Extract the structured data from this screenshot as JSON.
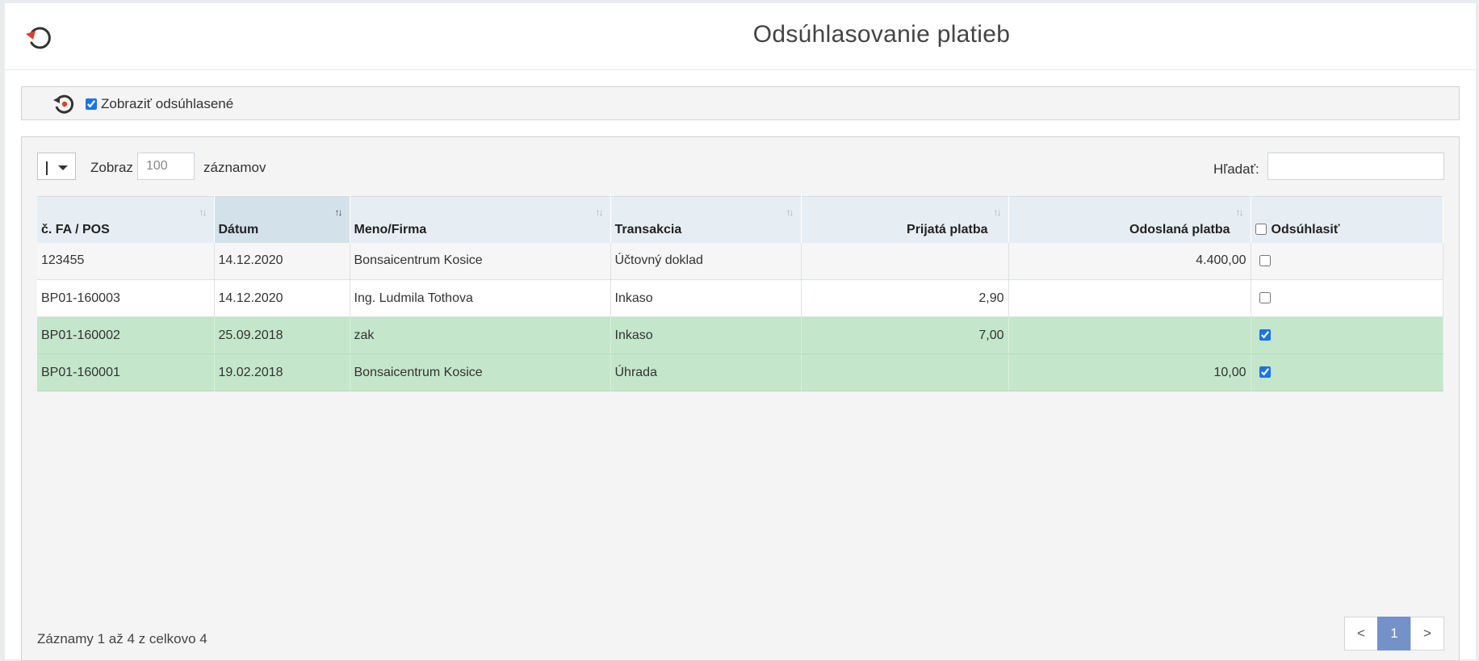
{
  "page": {
    "title": "Odsúhlasovanie platieb"
  },
  "filter": {
    "show_reconciled_label": "Zobraziť odsúhlasené",
    "show_reconciled_checked": true
  },
  "toolbar": {
    "length_label": "Zobraz",
    "length_value": "100",
    "length_suffix": "záznamov",
    "search_label": "Hľadať:",
    "search_value": ""
  },
  "table": {
    "columns": [
      "č. FA / POS",
      "Dátum",
      "Meno/Firma",
      "Transakcia",
      "Prijatá platba",
      "Odoslaná platba",
      "Odsúhlasiť"
    ],
    "sorted_column": "Dátum",
    "rows": [
      {
        "doc": "123455",
        "date": "14.12.2020",
        "name": "Bonsaicentrum Kosice",
        "transaction": "Účtovný doklad",
        "received": "",
        "sent": "4.400,00",
        "reconciled": false
      },
      {
        "doc": "BP01-160003",
        "date": "14.12.2020",
        "name": "Ing. Ludmila Tothova",
        "transaction": "Inkaso",
        "received": "2,90",
        "sent": "",
        "reconciled": false
      },
      {
        "doc": "BP01-160002",
        "date": "25.09.2018",
        "name": "zak",
        "transaction": "Inkaso",
        "received": "7,00",
        "sent": "",
        "reconciled": true
      },
      {
        "doc": "BP01-160001",
        "date": "19.02.2018",
        "name": "Bonsaicentrum Kosice",
        "transaction": "Úhrada",
        "received": "",
        "sent": "10,00",
        "reconciled": true
      }
    ]
  },
  "footer": {
    "info": "Záznamy 1 až 4 z celkovo 4"
  },
  "pagination": {
    "prev": "<",
    "current": "1",
    "next": ">"
  },
  "colors": {
    "reconciled_row": "#c4e6cb",
    "active_page": "#7492c8",
    "back_icon": "#d9422e"
  }
}
